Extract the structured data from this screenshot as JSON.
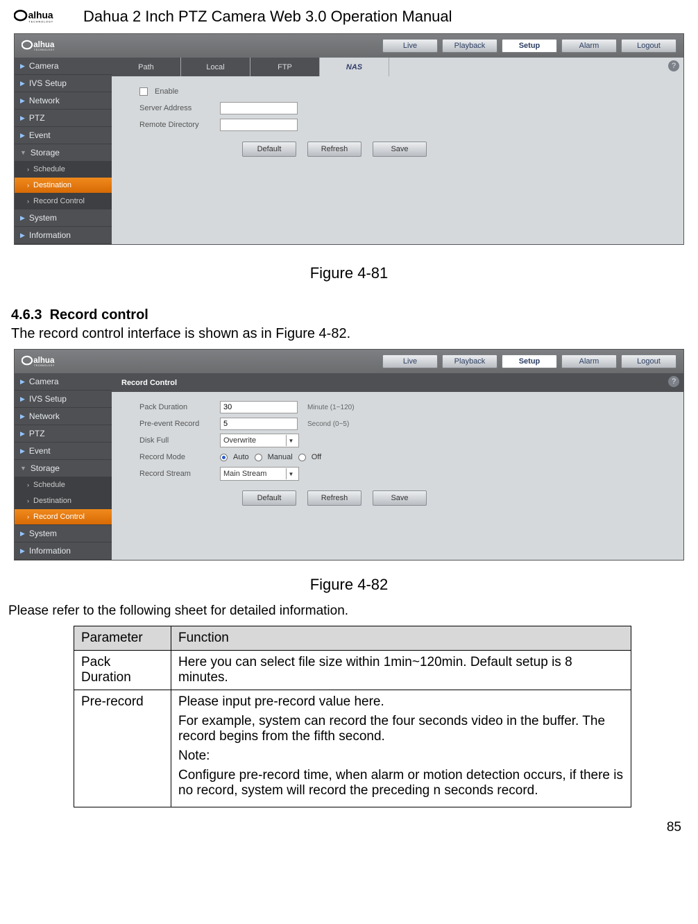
{
  "header": {
    "title": "Dahua 2 Inch PTZ Camera Web 3.0 Operation Manual",
    "brand": "alhua",
    "brand_sub": "TECHNOLOGY"
  },
  "nav": {
    "live": "Live",
    "playback": "Playback",
    "setup": "Setup",
    "alarm": "Alarm",
    "logout": "Logout"
  },
  "sidebar": {
    "camera": "Camera",
    "ivs": "IVS Setup",
    "network": "Network",
    "ptz": "PTZ",
    "event": "Event",
    "storage": "Storage",
    "schedule": "Schedule",
    "destination": "Destination",
    "record_control": "Record Control",
    "system": "System",
    "information": "Information"
  },
  "shot1": {
    "tabs": {
      "path": "Path",
      "local": "Local",
      "ftp": "FTP",
      "nas": "NAS"
    },
    "enable": "Enable",
    "server_addr": "Server Address",
    "remote_dir": "Remote Directory",
    "default": "Default",
    "refresh": "Refresh",
    "save": "Save",
    "caption": "Figure 4-81"
  },
  "section": {
    "num": "4.6.3",
    "title": "Record control",
    "intro": "The record control interface is shown as in Figure 4-82."
  },
  "shot2": {
    "header": "Record Control",
    "pack_duration_lbl": "Pack Duration",
    "pack_duration_val": "30",
    "pack_duration_hint": "Minute (1~120)",
    "preevent_lbl": "Pre-event Record",
    "preevent_val": "5",
    "preevent_hint": "Second (0~5)",
    "disk_full_lbl": "Disk Full",
    "disk_full_val": "Overwrite",
    "record_mode_lbl": "Record Mode",
    "mode_auto": "Auto",
    "mode_manual": "Manual",
    "mode_off": "Off",
    "record_stream_lbl": "Record Stream",
    "record_stream_val": "Main Stream",
    "default": "Default",
    "refresh": "Refresh",
    "save": "Save",
    "caption": "Figure 4-82"
  },
  "sheet_intro": "Please refer to the following sheet for detailed information.",
  "table": {
    "h1": "Parameter",
    "h2": "Function",
    "r1p": "Pack Duration",
    "r1f": "Here you can select file size within 1min~120min. Default setup is 8 minutes.",
    "r2p": "Pre-record",
    "r2f1": "Please input pre-record value here.",
    "r2f2": "For example, system can record the four seconds video in the buffer. The record begins from the fifth second.",
    "r2f3": "Note:",
    "r2f4": "Configure pre-record time, when alarm or motion detection occurs, if there is no record, system will record the preceding n seconds record."
  },
  "page_num": "85"
}
